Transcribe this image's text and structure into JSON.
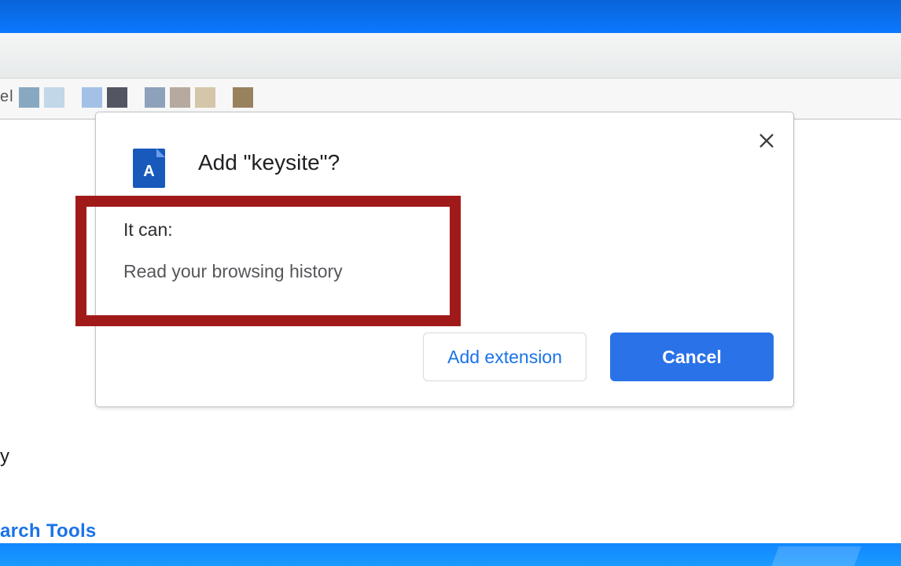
{
  "window": {
    "bookmarks_partial_text": "el"
  },
  "sidebar": {
    "partial_item": "y",
    "search_tools": "arch Tools"
  },
  "dialog": {
    "title": "Add \"keysite\"?",
    "icon_letter": "A",
    "permissions_lead": "It can:",
    "permissions": [
      "Read your browsing history"
    ],
    "add_button": "Add extension",
    "cancel_button": "Cancel"
  }
}
